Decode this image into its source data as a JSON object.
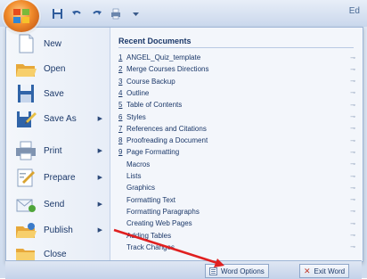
{
  "window": {
    "title_fragment": "Ed"
  },
  "qat": {
    "items": [
      "save-icon",
      "undo-icon",
      "redo-icon",
      "quickprint-icon",
      "customize-icon"
    ]
  },
  "commands": [
    {
      "label": "New",
      "icon": "new-document-icon",
      "has_submenu": false
    },
    {
      "label": "Open",
      "icon": "open-folder-icon",
      "has_submenu": false
    },
    {
      "label": "Save",
      "icon": "save-icon",
      "has_submenu": false
    },
    {
      "label": "Save As",
      "icon": "save-as-icon",
      "has_submenu": true
    },
    {
      "label": "Print",
      "icon": "print-icon",
      "has_submenu": true
    },
    {
      "label": "Prepare",
      "icon": "prepare-icon",
      "has_submenu": true
    },
    {
      "label": "Send",
      "icon": "send-icon",
      "has_submenu": true
    },
    {
      "label": "Publish",
      "icon": "publish-icon",
      "has_submenu": true
    },
    {
      "label": "Close",
      "icon": "close-folder-icon",
      "has_submenu": false
    }
  ],
  "recent": {
    "header": "Recent Documents",
    "items": [
      {
        "num": "1",
        "name": "ANGEL_Quiz_template"
      },
      {
        "num": "2",
        "name": "Merge Courses Directions"
      },
      {
        "num": "3",
        "name": "Course Backup"
      },
      {
        "num": "4",
        "name": "Outline"
      },
      {
        "num": "5",
        "name": "Table of Contents"
      },
      {
        "num": "6",
        "name": "Styles"
      },
      {
        "num": "7",
        "name": "References and Citations"
      },
      {
        "num": "8",
        "name": "Proofreading a Document"
      },
      {
        "num": "9",
        "name": "Page Formatting"
      },
      {
        "num": "",
        "name": "Macros"
      },
      {
        "num": "",
        "name": "Lists"
      },
      {
        "num": "",
        "name": "Graphics"
      },
      {
        "num": "",
        "name": "Formatting Text"
      },
      {
        "num": "",
        "name": "Formatting Paragraphs"
      },
      {
        "num": "",
        "name": "Creating Web Pages"
      },
      {
        "num": "",
        "name": "Adding Tables"
      },
      {
        "num": "",
        "name": "Track Changes"
      }
    ]
  },
  "bottom": {
    "word_options": "Word Options",
    "exit_word": "Exit Word"
  },
  "colors": {
    "office_button": "#f08a2a",
    "annotation_arrow": "#e02020",
    "text": "#1b3869"
  }
}
